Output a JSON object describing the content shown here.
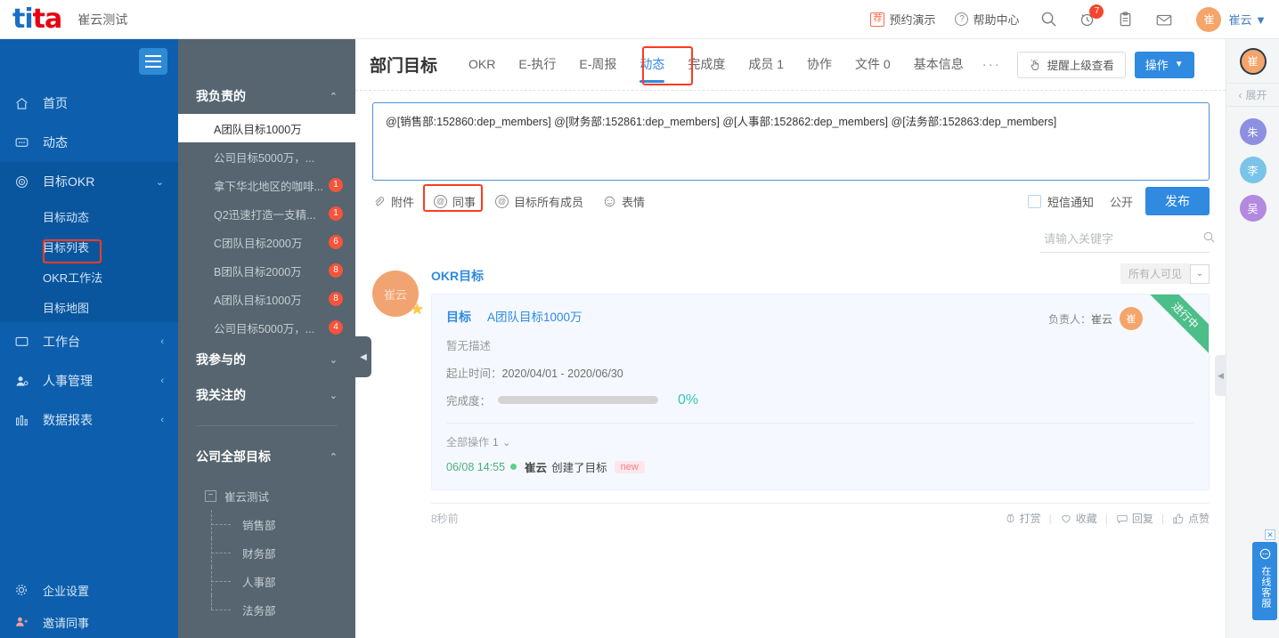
{
  "topbar": {
    "logo_blue": "ti",
    "logo_red": "ta",
    "org": "崔云测试",
    "recommend_badge": "荐",
    "demo_label": "预约演示",
    "help_mark": "?",
    "help_label": "帮助中心",
    "search_icon": "search-icon",
    "notify_count": "7",
    "avatar_initial": "崔",
    "user_name": "崔云",
    "caret": "▼"
  },
  "leftnav": {
    "items": [
      {
        "label": "首页",
        "icon": "home-icon",
        "arrow": ""
      },
      {
        "label": "动态",
        "icon": "chat-icon",
        "arrow": ""
      },
      {
        "label": "目标OKR",
        "icon": "target-icon",
        "arrow": "⌄"
      },
      {
        "label": "工作台",
        "icon": "monitor-icon",
        "arrow": "‹"
      },
      {
        "label": "人事管理",
        "icon": "user-icon",
        "arrow": "‹"
      },
      {
        "label": "数据报表",
        "icon": "chart-icon",
        "arrow": "‹"
      }
    ],
    "sub_items": [
      {
        "label": "目标动态"
      },
      {
        "label": "目标列表",
        "selected": true
      },
      {
        "label": "OKR工作法"
      },
      {
        "label": "目标地图"
      }
    ],
    "bottom": [
      {
        "label": "企业设置",
        "icon": "gear-icon"
      },
      {
        "label": "邀请同事",
        "icon": "invite-icon"
      }
    ]
  },
  "panel2": {
    "sections": [
      {
        "title": "我负责的",
        "arrow": "⌃"
      },
      {
        "title": "我参与的",
        "arrow": "⌄"
      },
      {
        "title": "我关注的",
        "arrow": "⌄"
      },
      {
        "title": "公司全部目标",
        "arrow": "⌃"
      }
    ],
    "goals": [
      {
        "label": "A团队目标1000万",
        "count": "",
        "active": true
      },
      {
        "label": "公司目标5000万，...",
        "count": ""
      },
      {
        "label": "拿下华北地区的咖啡...",
        "count": "1"
      },
      {
        "label": "Q2迅速打造一支精...",
        "count": "1"
      },
      {
        "label": "C团队目标2000万",
        "count": "6"
      },
      {
        "label": "B团队目标2000万",
        "count": "8"
      },
      {
        "label": "A团队目标1000万",
        "count": "8"
      },
      {
        "label": "公司目标5000万，...",
        "count": "4"
      }
    ],
    "tree": {
      "root": "崔云测试",
      "root_toggle": "−",
      "children": [
        "销售部",
        "财务部",
        "人事部",
        "法务部"
      ]
    }
  },
  "main": {
    "page_title": "部门目标",
    "tabs": [
      {
        "label": "OKR"
      },
      {
        "label": "E-执行"
      },
      {
        "label": "E-周报"
      },
      {
        "label": "动态",
        "active": true
      },
      {
        "label": "完成度"
      },
      {
        "label": "成员 1"
      },
      {
        "label": "协作"
      },
      {
        "label": "文件 0"
      },
      {
        "label": "基本信息"
      }
    ],
    "tab_more": "···",
    "remind_button": "提醒上级查看",
    "operate_button": "操作",
    "operate_caret": "▼"
  },
  "compose": {
    "text": "@[销售部:152860:dep_members] @[财务部:152861:dep_members] @[人事部:152862:dep_members] @[法务部:152863:dep_members]",
    "tools": [
      {
        "label": "附件",
        "icon": "paperclip-icon"
      },
      {
        "label": "同事",
        "icon": "at-icon",
        "highlighted": true
      },
      {
        "label": "目标所有成员",
        "icon": "at-icon"
      },
      {
        "label": "表情",
        "icon": "smiley-icon"
      }
    ],
    "sms_label": "短信通知",
    "public_label": "公开",
    "publish_label": "发布"
  },
  "search": {
    "placeholder": "请输入关键字",
    "icon": "search-icon"
  },
  "feed": {
    "avatar_text": "崔云",
    "title": "OKR目标",
    "visibility": "所有人可见",
    "visibility_caret": "⌄",
    "goal_label": "目标",
    "goal_name": "A团队目标1000万",
    "owner_label": "负责人：",
    "owner_name": "崔云",
    "owner_initial": "崔",
    "status_ribbon": "进行中",
    "description": "暂无描述",
    "date_label": "起止时间：",
    "date_value": "2020/04/01 - 2020/06/30",
    "progress_label": "完成度：",
    "progress_value": "0%",
    "ops_header": "全部操作",
    "ops_count": "1",
    "ops_caret": "⌄",
    "op_time": "06/08 14:55",
    "op_user": "崔云",
    "op_action": "创建了目标",
    "op_badge": "new",
    "footer_time": "8秒前",
    "actions": [
      {
        "label": "打赏",
        "icon": "coin-icon"
      },
      {
        "label": "收藏",
        "icon": "heart-icon"
      },
      {
        "label": "回复",
        "icon": "comment-icon"
      },
      {
        "label": "点赞",
        "icon": "thumbsup-icon"
      }
    ]
  },
  "rail": {
    "main_avatar": "崔",
    "expand_label": "展开",
    "expand_caret": "‹",
    "avatars": [
      {
        "initial": "朱",
        "color": "#8d8fe0"
      },
      {
        "initial": "李",
        "color": "#79c4e8"
      },
      {
        "initial": "吴",
        "color": "#b38ae0"
      }
    ],
    "collapse_caret": "◀",
    "service_close": "✕",
    "service_label": "在线客服"
  },
  "colors": {
    "brand_blue": "#0d5fae",
    "accent_blue": "#2f8ae0",
    "highlight_red": "#ff3b1f",
    "badge_red": "#f4543c",
    "progress_teal": "#34c7b5",
    "ribbon_green": "#4cbe88",
    "panel_gray": "#56656f"
  }
}
